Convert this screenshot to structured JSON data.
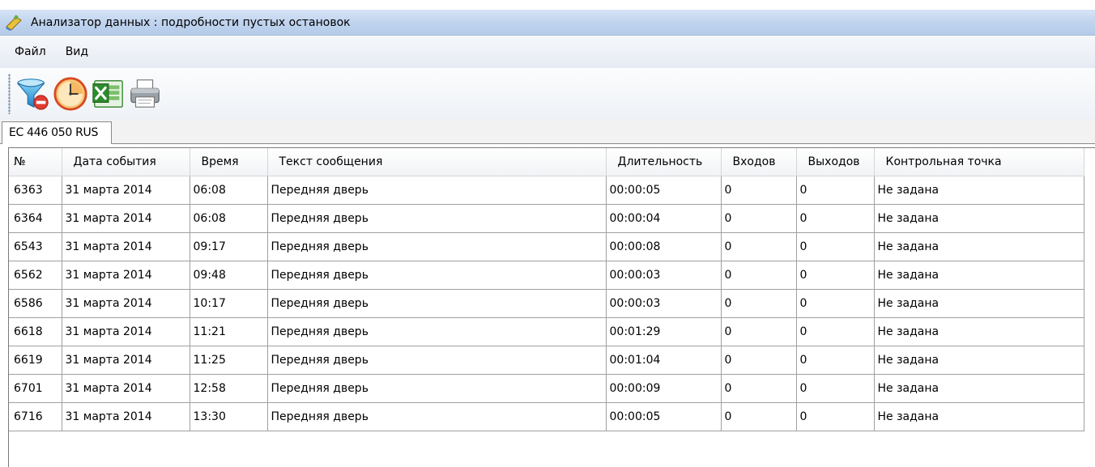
{
  "window": {
    "title": "Анализатор данных : подробности пустых остановок",
    "app_icon": "data-analyzer-icon"
  },
  "menu": [
    {
      "label": "Файл"
    },
    {
      "label": "Вид"
    }
  ],
  "toolbar": {
    "buttons": [
      {
        "icon": "filter-remove-icon"
      },
      {
        "icon": "clock-icon"
      },
      {
        "icon": "excel-export-icon"
      },
      {
        "icon": "printer-icon"
      }
    ]
  },
  "tabs": [
    {
      "label": "EC 446 050 RUS",
      "selected": true
    }
  ],
  "table": {
    "columns": [
      "№",
      "Дата события",
      "Время",
      "Текст сообщения",
      "Длительность",
      "Входов",
      "Выходов",
      "Контрольная точка"
    ],
    "rows": [
      [
        "6363",
        "31 марта 2014",
        "06:08",
        "Передняя дверь",
        "00:00:05",
        "0",
        "0",
        "Не задана"
      ],
      [
        "6364",
        "31 марта 2014",
        "06:08",
        "Передняя дверь",
        "00:00:04",
        "0",
        "0",
        "Не задана"
      ],
      [
        "6543",
        "31 марта 2014",
        "09:17",
        "Передняя дверь",
        "00:00:08",
        "0",
        "0",
        "Не задана"
      ],
      [
        "6562",
        "31 марта 2014",
        "09:48",
        "Передняя дверь",
        "00:00:03",
        "0",
        "0",
        "Не задана"
      ],
      [
        "6586",
        "31 марта 2014",
        "10:17",
        "Передняя дверь",
        "00:00:03",
        "0",
        "0",
        "Не задана"
      ],
      [
        "6618",
        "31 марта 2014",
        "11:21",
        "Передняя дверь",
        "00:01:29",
        "0",
        "0",
        "Не задана"
      ],
      [
        "6619",
        "31 марта 2014",
        "11:25",
        "Передняя дверь",
        "00:01:04",
        "0",
        "0",
        "Не задана"
      ],
      [
        "6701",
        "31 марта 2014",
        "12:58",
        "Передняя дверь",
        "00:00:09",
        "0",
        "0",
        "Не задана"
      ],
      [
        "6716",
        "31 марта 2014",
        "13:30",
        "Передняя дверь",
        "00:00:05",
        "0",
        "0",
        "Не задана"
      ]
    ]
  }
}
